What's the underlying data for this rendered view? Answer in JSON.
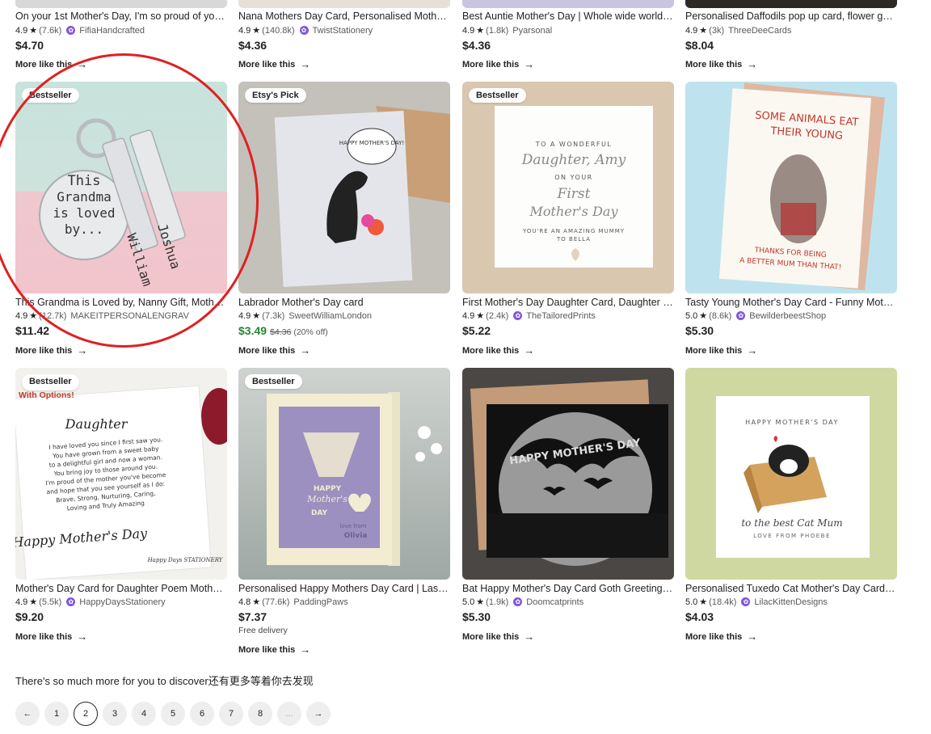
{
  "row1": [
    {
      "title": "On your 1st Mother's Day, I'm so proud of you, ...",
      "rating": "4.9",
      "reviews": "(7.6k)",
      "shop": "FifiaHandcrafted",
      "price": "$4.70",
      "more": "More like this"
    },
    {
      "title": "Nana Mothers Day Card, Personalised Mothers...",
      "rating": "4.9",
      "reviews": "(140.8k)",
      "shop": "TwistStationery",
      "price": "$4.36",
      "more": "More like this"
    },
    {
      "title": "Best Auntie Mother's Day | Whole wide world | ...",
      "rating": "4.9",
      "reviews": "(1.8k)",
      "shop": "Pyarsonal",
      "price": "$4.36",
      "more": "More like this"
    },
    {
      "title": "Personalised Daffodils pop up card, flower gar...",
      "rating": "4.9",
      "reviews": "(3k)",
      "shop": "ThreeDeeCards",
      "price": "$8.04",
      "more": "More like this"
    }
  ],
  "row2": [
    {
      "badge": "Bestseller",
      "title": "This Grandma is Loved by, Nanny Gift, Mother'...",
      "rating": "4.9",
      "reviews": "(12.7k)",
      "shop": "MAKEITPERSONALENGRAV",
      "price": "$11.42",
      "more": "More like this",
      "img": {
        "line1": "This",
        "line2": "Grandma",
        "line3": "is loved",
        "line4": "by...",
        "tag1": "Joshua",
        "tag2": "William"
      }
    },
    {
      "badge": "Etsy's Pick",
      "title": "Labrador Mother's Day card",
      "rating": "4.9",
      "reviews": "(7.3k)",
      "shop": "SweetWilliamLondon",
      "price": "$3.49",
      "orig": "$4.36",
      "pct": "(20% off)",
      "more": "More like this",
      "img": {
        "bubble": "HAPPY MOTHER'S DAY!"
      }
    },
    {
      "badge": "Bestseller",
      "title": "First Mother's Day Daughter Card, Daughter m...",
      "rating": "4.9",
      "reviews": "(2.4k)",
      "shop": "TheTailoredPrints",
      "price": "$5.22",
      "more": "More like this",
      "img": {
        "l1": "TO A WONDERFUL",
        "l2": "Daughter, Amy",
        "l3": "ON YOUR",
        "l4": "First",
        "l5": "Mother's Day",
        "l6": "YOU'RE AN AMAZING MUMMY",
        "l7": "TO BELLA"
      }
    },
    {
      "title": "Tasty Young Mother's Day Card - Funny Mothe...",
      "rating": "5.0",
      "reviews": "(8.6k)",
      "shop": "BewilderbeestShop",
      "price": "$5.30",
      "more": "More like this",
      "img": {
        "top1": "SOME ANIMALS EAT",
        "top2": "THEIR YOUNG",
        "bot1": "THANKS FOR BEING",
        "bot2": "A BETTER MUM THAN THAT!"
      }
    }
  ],
  "row3": [
    {
      "badge": "Bestseller",
      "sub": "With Options!",
      "title": "Mother's Day Card for Daughter Poem Mother'...",
      "rating": "4.9",
      "reviews": "(5.5k)",
      "shop": "HappyDaysStationery",
      "price": "$9.20",
      "more": "More like this",
      "img": {
        "head": "Daughter",
        "poem": [
          "I have loved you since I first saw you.",
          "You have grown from a sweet baby",
          "to a delightful girl and now a woman.",
          "You bring joy to those around you.",
          "I'm proud of the mother you've become",
          "and hope that you see yourself as I do:",
          "Brave, Strong, Nurturing, Caring,",
          "Loving and Truly Amazing"
        ],
        "foot": "Happy Mother's Day",
        "brand": "Happy Days STATIONERY"
      }
    },
    {
      "badge": "Bestseller",
      "title": "Personalised Happy Mothers Day Card | Laser ...",
      "rating": "4.8",
      "reviews": "(77.6k)",
      "shop": "PaddingPaws",
      "price": "$7.37",
      "delivery": "Free delivery",
      "more": "More like this",
      "img": {
        "t1": "HAPPY",
        "t2": "Mother's",
        "t3": "DAY",
        "t4": "love from",
        "t5": "Olivia"
      }
    },
    {
      "title": "Bat Happy Mother's Day Card Goth Greetings ...",
      "rating": "5.0",
      "reviews": "(1.9k)",
      "shop": "Doomcatprints",
      "price": "$5.30",
      "more": "More like this",
      "img": {
        "text": "HAPPY MOTHER'S DAY"
      }
    },
    {
      "title": "Personalised Tuxedo Cat Mother's Day Card | F...",
      "rating": "5.0",
      "reviews": "(18.4k)",
      "shop": "LilacKittenDesigns",
      "price": "$4.03",
      "more": "More like this",
      "img": {
        "arc": "HAPPY MOTHER'S DAY",
        "l1": "to the best Cat Mum",
        "l2": "LOVE FROM PHOEBE"
      }
    }
  ],
  "discover": "There's so much more for you to discover还有更多等着你去发现",
  "pager": {
    "prev": "←",
    "pages": [
      "1",
      "2",
      "3",
      "4",
      "5",
      "6",
      "7",
      "8"
    ],
    "current": "2",
    "ellipsis": "...",
    "next": "→"
  },
  "colors": {
    "sale": "#258635",
    "annotation": "#e02020",
    "shop_badge": "#7f56d9"
  }
}
